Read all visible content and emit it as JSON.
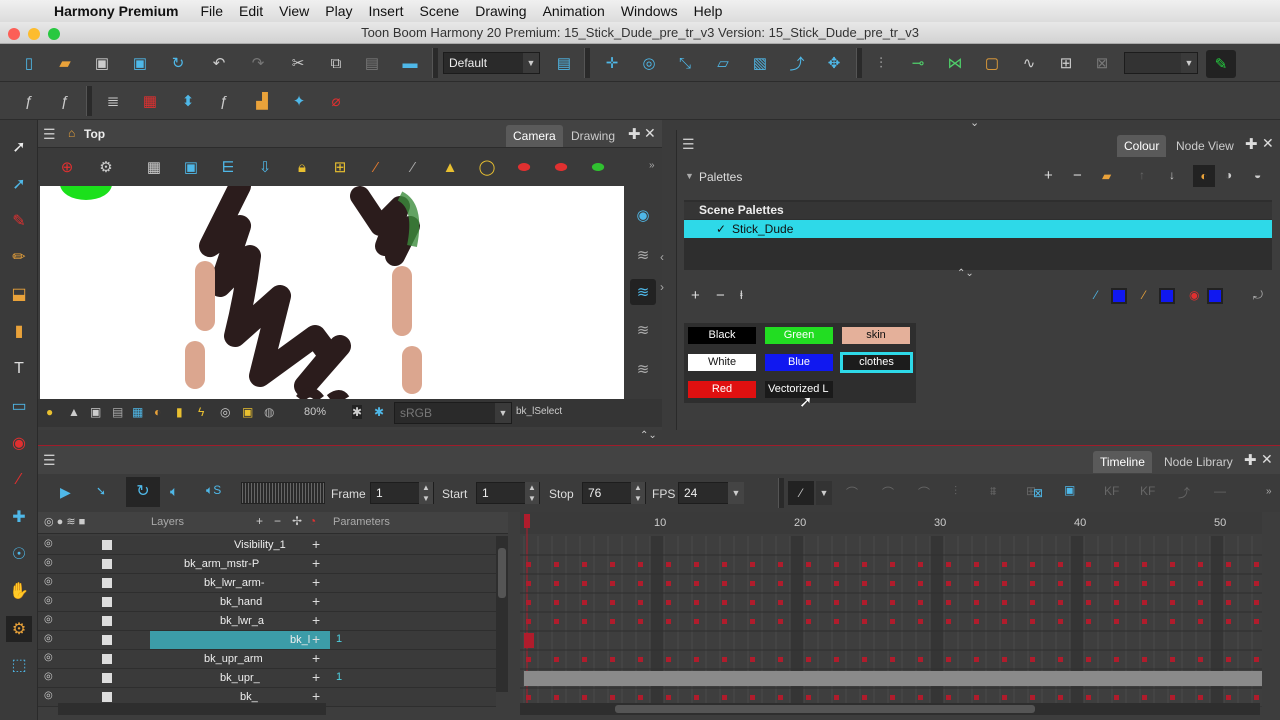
{
  "menubar": {
    "app": "Harmony Premium",
    "items": [
      "File",
      "Edit",
      "View",
      "Play",
      "Insert",
      "Scene",
      "Drawing",
      "Animation",
      "Windows",
      "Help"
    ]
  },
  "window": {
    "title": "Toon Boom Harmony 20 Premium: 15_Stick_Dude_pre_tr_v3 Version: 15_Stick_Dude_pre_tr_v3"
  },
  "toolbar": {
    "workspace": "Default"
  },
  "camera": {
    "breadcrumb": "Top",
    "tabs": [
      "Camera",
      "Drawing"
    ],
    "zoom": "80%",
    "colorspace": "sRGB",
    "status": "bk_lSelect"
  },
  "colour": {
    "tabs": [
      "Colour",
      "Node View"
    ],
    "section": "Palettes",
    "palette_header": "Scene Palettes",
    "palette_item": "Stick_Dude",
    "swatches": [
      {
        "label": "Black",
        "bg": "#000000",
        "fg": "#ffffff"
      },
      {
        "label": "Green",
        "bg": "#22dd22",
        "fg": "#ffffff"
      },
      {
        "label": "skin",
        "bg": "#e4b09a",
        "fg": "#111111"
      },
      {
        "label": "White",
        "bg": "#ffffff",
        "fg": "#111111"
      },
      {
        "label": "Blue",
        "bg": "#1018f0",
        "fg": "#ffffff"
      },
      {
        "label": "clothes",
        "bg": "#1c1c1c",
        "fg": "#ffffff"
      },
      {
        "label": "Red",
        "bg": "#e01010",
        "fg": "#ffffff"
      },
      {
        "label": "Vectorized L",
        "bg": "#1a1a1a",
        "fg": "#ffffff"
      }
    ]
  },
  "timeline": {
    "tabs": [
      "Timeline",
      "Node Library"
    ],
    "frame_label": "Frame",
    "frame": "1",
    "start_label": "Start",
    "start": "1",
    "stop_label": "Stop",
    "stop": "76",
    "fps_label": "FPS",
    "fps": "24",
    "layers_header": "Layers",
    "params_header": "Parameters",
    "ruler": [
      "10",
      "20",
      "30",
      "40",
      "50"
    ],
    "layers": [
      {
        "name": "Visibility_1",
        "param": ""
      },
      {
        "name": "bk_arm_mstr-P",
        "param": ""
      },
      {
        "name": "bk_lwr_arm-",
        "param": ""
      },
      {
        "name": "bk_hand",
        "param": ""
      },
      {
        "name": "bk_lwr_a",
        "param": ""
      },
      {
        "name": "bk_l",
        "param": "1"
      },
      {
        "name": "bk_upr_arm",
        "param": ""
      },
      {
        "name": "bk_upr_",
        "param": "1"
      },
      {
        "name": "bk_",
        "param": ""
      }
    ]
  }
}
